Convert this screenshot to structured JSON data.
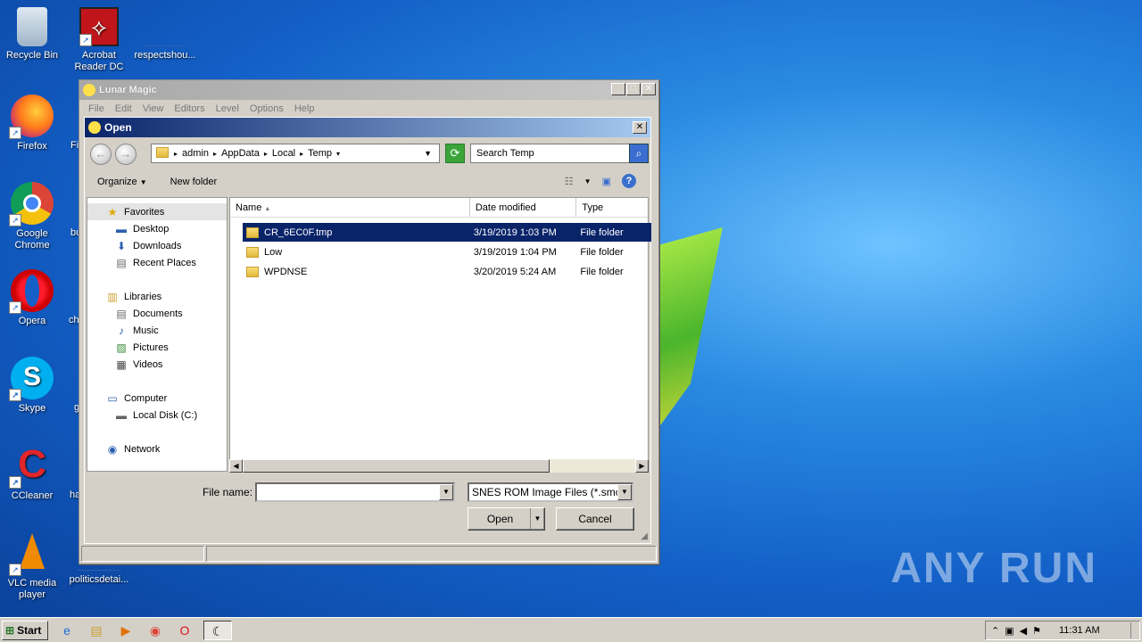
{
  "desktop": {
    "icons": [
      {
        "label": "Recycle Bin",
        "icon": "recycle-bin-icon"
      },
      {
        "label": "Acrobat Reader DC",
        "icon": "acrobat-icon"
      },
      {
        "label": "respectshou...",
        "icon": "file-icon"
      },
      {
        "label": "Firefox",
        "icon": "firefox-icon"
      },
      {
        "label": "Google Chrome",
        "icon": "chrome-icon"
      },
      {
        "label": "Opera",
        "icon": "opera-icon"
      },
      {
        "label": "Skype",
        "icon": "skype-icon"
      },
      {
        "label": "CCleaner",
        "icon": "ccleaner-icon"
      },
      {
        "label": "VLC media player",
        "icon": "vlc-icon"
      },
      {
        "label": "politicsdetai...",
        "icon": "file-icon"
      }
    ],
    "partial_labels": [
      "Fi",
      "bu",
      "ch",
      "g",
      "ha"
    ],
    "watermark": "ANY RUN"
  },
  "app": {
    "title": "Lunar Magic",
    "menu": [
      "File",
      "Edit",
      "View",
      "Editors",
      "Level",
      "Options",
      "Help"
    ]
  },
  "dialog": {
    "title": "Open",
    "breadcrumb": [
      "admin",
      "AppData",
      "Local",
      "Temp"
    ],
    "search_placeholder": "Search Temp",
    "organize_label": "Organize",
    "new_folder_label": "New folder",
    "nav": {
      "favorites": {
        "label": "Favorites",
        "items": [
          "Desktop",
          "Downloads",
          "Recent Places"
        ]
      },
      "libraries": {
        "label": "Libraries",
        "items": [
          "Documents",
          "Music",
          "Pictures",
          "Videos"
        ]
      },
      "computer": {
        "label": "Computer",
        "items": [
          "Local Disk (C:)"
        ]
      },
      "network": {
        "label": "Network"
      }
    },
    "columns": [
      "Name",
      "Date modified",
      "Type"
    ],
    "files": [
      {
        "name": "CR_6EC0F.tmp",
        "date": "3/19/2019 1:03 PM",
        "type": "File folder",
        "selected": true
      },
      {
        "name": "Low",
        "date": "3/19/2019 1:04 PM",
        "type": "File folder",
        "selected": false
      },
      {
        "name": "WPDNSE",
        "date": "3/20/2019 5:24 AM",
        "type": "File folder",
        "selected": false
      }
    ],
    "file_name_label": "File name:",
    "file_name_value": "",
    "file_type_value": "SNES ROM Image Files (*.smc,*",
    "open_label": "Open",
    "cancel_label": "Cancel"
  },
  "taskbar": {
    "start_label": "Start",
    "clock": "11:31 AM"
  }
}
